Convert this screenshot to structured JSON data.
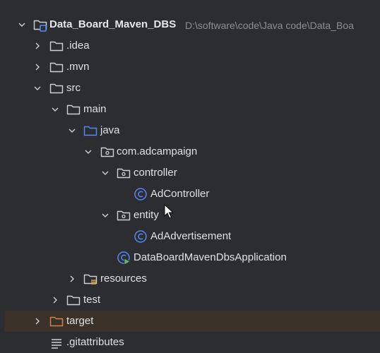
{
  "project": {
    "name": "Data_Board_Maven_DBS",
    "path": "D:\\software\\code\\Java code\\Data_Boa"
  },
  "items": {
    "idea": "idea",
    "mvn": "mvn",
    "src": "src",
    "main": "main",
    "java": "java",
    "package": "com.adcampaign",
    "controller": "controller",
    "ad_controller": "AdController",
    "entity": "entity",
    "ad_advertisement": "AdAdvertisement",
    "application": "DataBoardMavenDbsApplication",
    "resources": "resources",
    "test": "test",
    "target": "target",
    "gitattributes": "gitattributes"
  },
  "colors": {
    "background": "#2b2d30",
    "selected_row": "#3a3229",
    "folder": "#ced0d6",
    "source_folder": "#548af7",
    "class_icon": "#548af7",
    "excluded_folder": "#d7804f"
  }
}
